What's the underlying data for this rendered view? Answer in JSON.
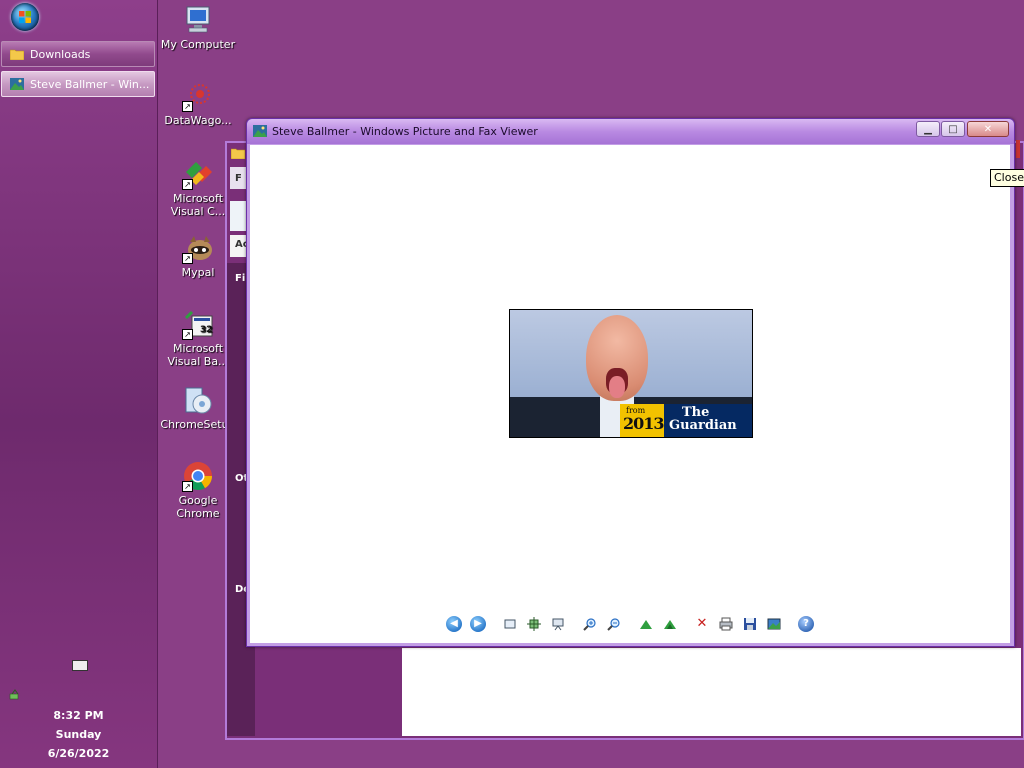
{
  "taskbar": {
    "buttons": [
      {
        "label": "Downloads",
        "icon": "folder-icon",
        "active": false
      },
      {
        "label": "Steve Ballmer - Win...",
        "icon": "picture-viewer-icon",
        "active": true
      }
    ],
    "clock": {
      "time": "8:32 PM",
      "day": "Sunday",
      "date": "6/26/2022"
    }
  },
  "desktop": {
    "icons": [
      {
        "label": "My Computer",
        "icon": "computer-icon"
      },
      {
        "label": "DataWago...",
        "icon": "datawagon-icon"
      },
      {
        "label": "Microsoft Visual C...",
        "icon": "visual-c-icon"
      },
      {
        "label": "Mypal",
        "icon": "mypal-icon"
      },
      {
        "label": "Microsoft Visual Ba...",
        "icon": "visual-basic-icon"
      },
      {
        "label": "ChromeSetup",
        "icon": "chrome-setup-icon"
      },
      {
        "label": "Google Chrome",
        "icon": "chrome-icon"
      }
    ]
  },
  "explorer": {
    "partial_labels": [
      "F",
      "Ac",
      "Fil",
      "Ot",
      "De"
    ]
  },
  "viewer": {
    "title": "Steve Ballmer - Windows Picture and Fax Viewer",
    "photo": {
      "badge_from": "from",
      "badge_year": "2013",
      "brand_line1": "The",
      "brand_line2": "Guardian"
    },
    "toolbar": {
      "previous": "previous-image-icon",
      "next": "next-image-icon",
      "best_fit": "best-fit-icon",
      "actual_size": "actual-size-icon",
      "slideshow": "slideshow-icon",
      "zoom_in": "zoom-in-icon",
      "zoom_out": "zoom-out-icon",
      "rotate_cw": "rotate-clockwise-icon",
      "rotate_ccw": "rotate-counterclockwise-icon",
      "delete": "delete-icon",
      "print": "print-icon",
      "save": "save-icon",
      "edit": "edit-icon",
      "help": "help-icon"
    }
  },
  "tooltip": {
    "text": "Close"
  }
}
